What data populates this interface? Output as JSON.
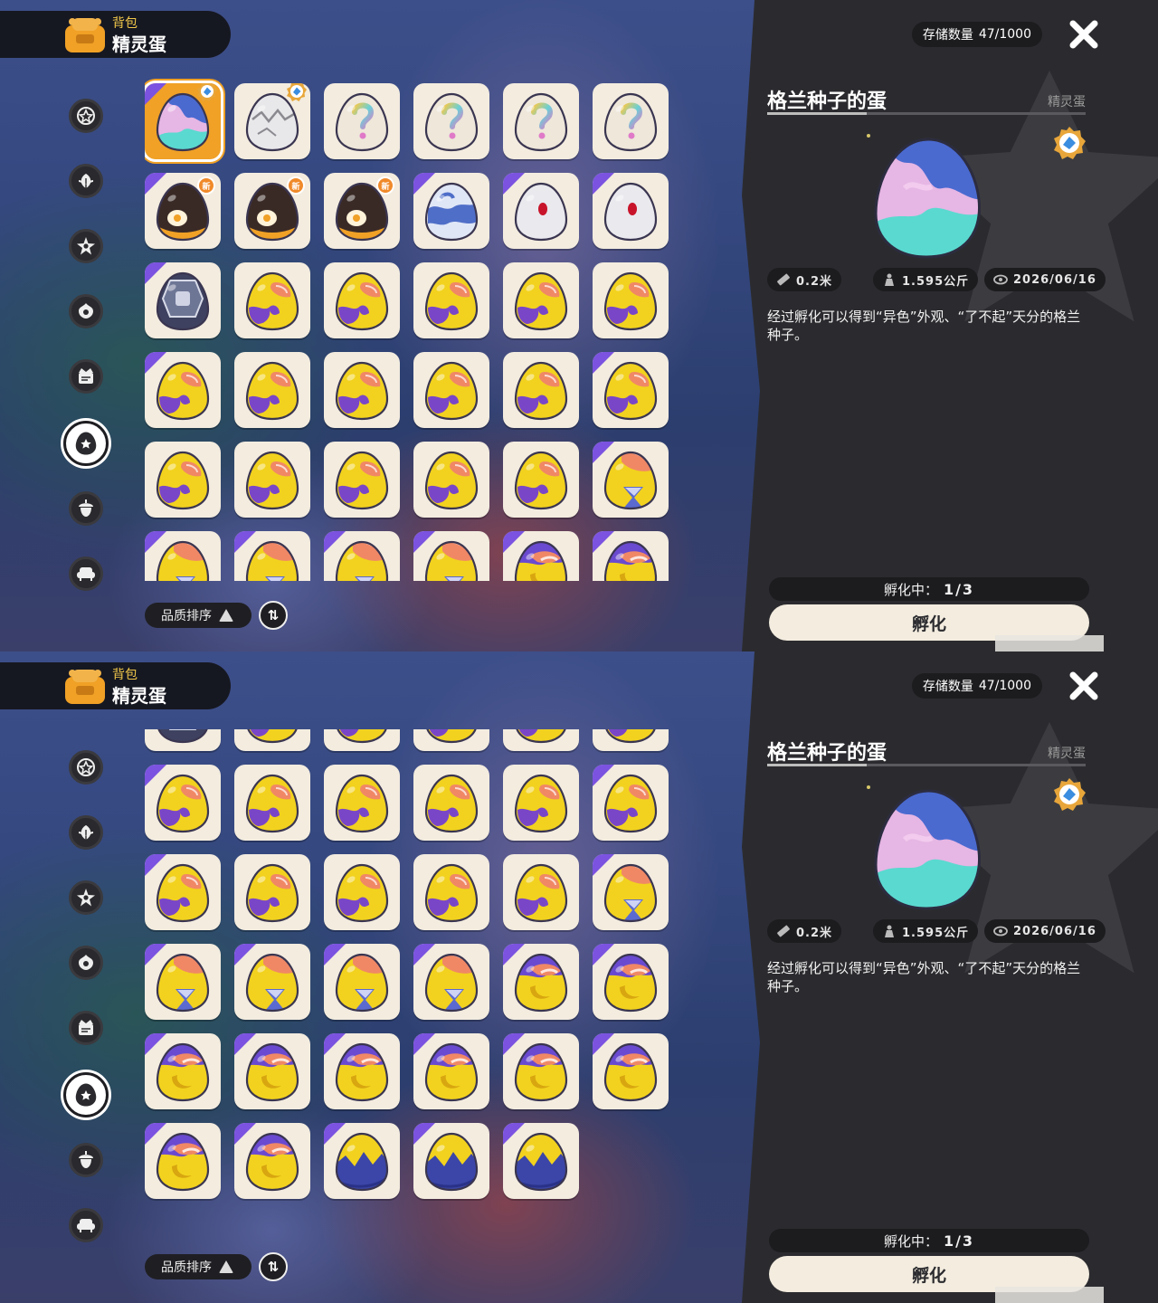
{
  "header": {
    "label": "背包",
    "title": "精灵蛋"
  },
  "categories": [
    {
      "icon": "star-badge-icon",
      "active": false
    },
    {
      "icon": "leaf-icon",
      "active": false
    },
    {
      "icon": "sparkle-star-icon",
      "active": false
    },
    {
      "icon": "flower-icon",
      "active": false
    },
    {
      "icon": "crown-scroll-icon",
      "active": false
    },
    {
      "icon": "egg-icon",
      "active": true
    },
    {
      "icon": "acorn-icon",
      "active": false
    },
    {
      "icon": "armchair-icon",
      "active": false
    }
  ],
  "sort": {
    "label": "品质排序",
    "toggle_label": "⇅"
  },
  "storage": {
    "label": "存储数量",
    "value": "47/1000"
  },
  "detail": {
    "name": "格兰种子的蛋",
    "category": "精灵蛋",
    "stats": [
      {
        "icon": "ruler-icon",
        "value": "0.2米"
      },
      {
        "icon": "weight-icon",
        "value": "1.595公斤"
      },
      {
        "icon": "eye-icon",
        "value": "2026/06/16"
      }
    ],
    "description": "经过孵化可以得到“异色”外观、“了不起”天分的格兰种子。",
    "hatching_label": "孵化中：",
    "hatching_value": "1/3",
    "hatch_button": "孵化"
  },
  "badge_new_text": "新",
  "colors": {
    "accent_orange": "#f0a126",
    "rare_purple": "#7b53e0",
    "panel": "#2b2b2f",
    "cell": "#f3ecdf"
  },
  "screens": [
    {
      "scroll_rows_offset": 0,
      "eggs": [
        {
          "type": "grand",
          "rare": true,
          "selected": true,
          "shiny": true
        },
        {
          "type": "cracked",
          "shiny": true
        },
        {
          "type": "rainbow-q"
        },
        {
          "type": "rainbow-q"
        },
        {
          "type": "rainbow-q"
        },
        {
          "type": "rainbow-q"
        },
        {
          "type": "penguin",
          "rare": true,
          "new": true
        },
        {
          "type": "penguin",
          "new": true
        },
        {
          "type": "penguin",
          "new": true
        },
        {
          "type": "cloud",
          "rare": true
        },
        {
          "type": "red-dot",
          "rare": true
        },
        {
          "type": "red-dot",
          "rare": true
        },
        {
          "type": "dark-shell",
          "rare": true
        },
        {
          "type": "yellow-purple"
        },
        {
          "type": "yellow-purple"
        },
        {
          "type": "yellow-purple"
        },
        {
          "type": "yellow-purple"
        },
        {
          "type": "yellow-purple"
        },
        {
          "type": "yellow-purple",
          "rare": true
        },
        {
          "type": "yellow-purple"
        },
        {
          "type": "yellow-purple"
        },
        {
          "type": "yellow-purple"
        },
        {
          "type": "yellow-purple"
        },
        {
          "type": "yellow-purple",
          "rare": true
        },
        {
          "type": "yellow-purple"
        },
        {
          "type": "yellow-purple"
        },
        {
          "type": "yellow-purple"
        },
        {
          "type": "yellow-purple"
        },
        {
          "type": "yellow-purple"
        },
        {
          "type": "hourglass",
          "rare": true
        },
        {
          "type": "hourglass",
          "rare": true
        },
        {
          "type": "hourglass",
          "rare": true
        },
        {
          "type": "hourglass",
          "rare": true
        },
        {
          "type": "hourglass",
          "rare": true
        },
        {
          "type": "moon",
          "rare": true
        },
        {
          "type": "moon",
          "rare": true
        }
      ]
    },
    {
      "scroll_rows_offset": 1,
      "eggs": [
        {
          "type": "dark-shell"
        },
        {
          "type": "yellow-purple"
        },
        {
          "type": "yellow-purple"
        },
        {
          "type": "yellow-purple"
        },
        {
          "type": "yellow-purple"
        },
        {
          "type": "yellow-purple"
        },
        {
          "type": "yellow-purple",
          "rare": true
        },
        {
          "type": "yellow-purple"
        },
        {
          "type": "yellow-purple"
        },
        {
          "type": "yellow-purple"
        },
        {
          "type": "yellow-purple"
        },
        {
          "type": "yellow-purple",
          "rare": true
        },
        {
          "type": "yellow-purple",
          "rare": true
        },
        {
          "type": "yellow-purple"
        },
        {
          "type": "yellow-purple"
        },
        {
          "type": "yellow-purple"
        },
        {
          "type": "yellow-purple"
        },
        {
          "type": "hourglass",
          "rare": true
        },
        {
          "type": "hourglass",
          "rare": true
        },
        {
          "type": "hourglass",
          "rare": true
        },
        {
          "type": "hourglass",
          "rare": true
        },
        {
          "type": "hourglass",
          "rare": true
        },
        {
          "type": "moon",
          "rare": true
        },
        {
          "type": "moon",
          "rare": true
        },
        {
          "type": "moon",
          "rare": true
        },
        {
          "type": "moon",
          "rare": true
        },
        {
          "type": "moon",
          "rare": true
        },
        {
          "type": "moon",
          "rare": true
        },
        {
          "type": "moon",
          "rare": true
        },
        {
          "type": "moon",
          "rare": true
        },
        {
          "type": "moon",
          "rare": true
        },
        {
          "type": "moon",
          "rare": true
        },
        {
          "type": "navy-crown",
          "rare": true
        },
        {
          "type": "navy-crown",
          "rare": true
        },
        {
          "type": "navy-crown",
          "rare": true
        }
      ]
    }
  ]
}
